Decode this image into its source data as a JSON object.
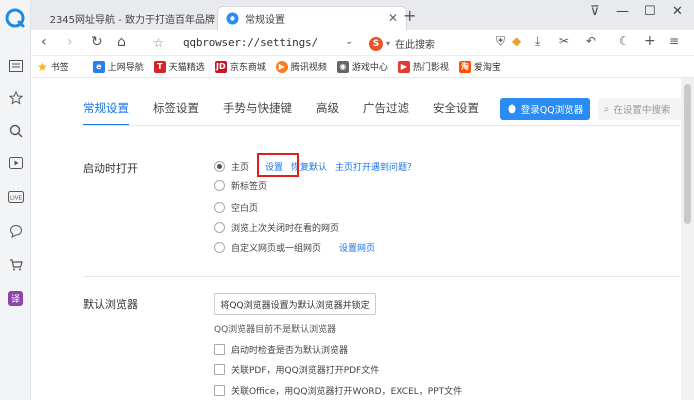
{
  "tabs": [
    {
      "title": "2345网址导航 - 致力于打造百年品牌",
      "active": false
    },
    {
      "title": "常规设置",
      "active": true
    }
  ],
  "address": {
    "url": "qqbrowser://settings/",
    "search_text": "在此搜索"
  },
  "bookmarks": [
    {
      "label": "书签",
      "icon": "star-icon",
      "color": "#f2b01e"
    },
    {
      "label": "上网导航",
      "icon": "e-icon",
      "color": "#2a7fe8"
    },
    {
      "label": "天猫精选",
      "icon": "tmall-icon",
      "color": "#d4232c"
    },
    {
      "label": "京东商城",
      "icon": "jd-icon",
      "color": "#c7172a"
    },
    {
      "label": "腾讯视频",
      "icon": "video-icon",
      "color": "#ff7a1a"
    },
    {
      "label": "游戏中心",
      "icon": "game-icon",
      "color": "#666666"
    },
    {
      "label": "热门影视",
      "icon": "film-icon",
      "color": "#e23b2f"
    },
    {
      "label": "爱淘宝",
      "icon": "taobao-icon",
      "color": "#ff5000"
    }
  ],
  "settings_tabs": [
    "常规设置",
    "标签设置",
    "手势与快捷键",
    "高级",
    "广告过滤",
    "安全设置"
  ],
  "login_button": "登录QQ浏览器",
  "search_settings_placeholder": "在设置中搜索",
  "startup": {
    "label": "启动时打开",
    "options": [
      "主页",
      "新标签页",
      "空白页",
      "浏览上次关闭时在看的网页",
      "自定义网页或一组网页"
    ],
    "selected": 0,
    "home_links": [
      "设置",
      "恢复默认",
      "主页打开遇到问题？"
    ],
    "custom_link": "设置网页"
  },
  "default_browser": {
    "label": "默认浏览器",
    "button": "将QQ浏览器设置为默认浏览器并锁定",
    "status": "QQ浏览器目前不是默认浏览器",
    "checkboxes": [
      "启动时检查是否为默认浏览器",
      "关联PDF，用QQ浏览器打开PDF文件",
      "关联Office，用QQ浏览器打开WORD，EXCEL，PPT文件"
    ]
  },
  "colors": {
    "accent": "#1a73e8",
    "login_bg": "#2a8bf2",
    "highlight": "#e01e1e"
  }
}
